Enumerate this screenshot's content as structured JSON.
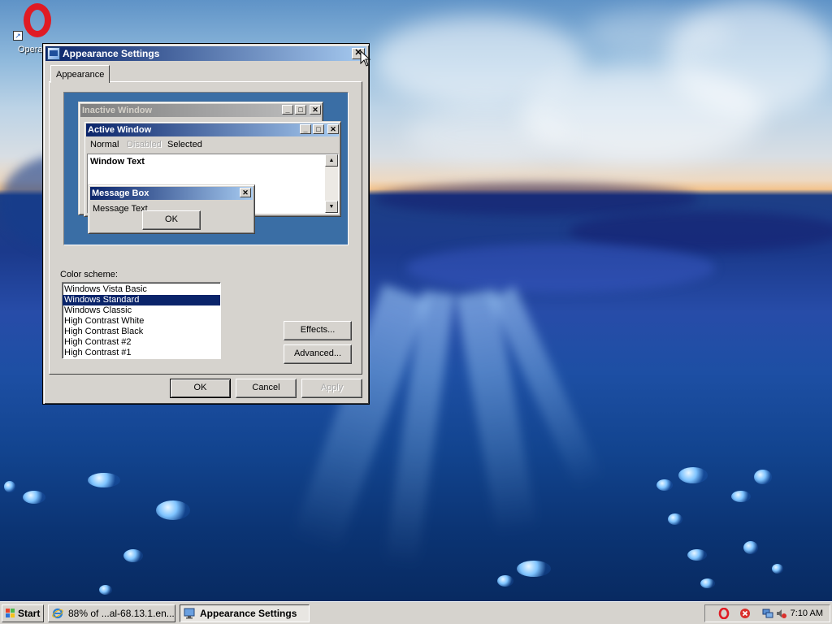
{
  "desktop": {
    "icons": [
      {
        "label": "Opera",
        "icon": "opera-icon"
      }
    ]
  },
  "dialog": {
    "title": "Appearance Settings",
    "close_label": "✕",
    "tab_label": "Appearance",
    "preview": {
      "inactive_title": "Inactive Window",
      "active_title": "Active Window",
      "menu_normal": "Normal",
      "menu_disabled": "Disabled",
      "menu_selected": "Selected",
      "window_text": "Window Text",
      "message_box_title": "Message Box",
      "message_text": "Message Text",
      "message_ok": "OK"
    },
    "color_scheme_label": "Color scheme:",
    "color_schemes": [
      "Windows Vista Basic",
      "Windows Standard",
      "Windows Classic",
      "High Contrast White",
      "High Contrast Black",
      "High Contrast #2",
      "High Contrast #1"
    ],
    "selected_scheme_index": 1,
    "effects_label": "Effects...",
    "advanced_label": "Advanced...",
    "ok_label": "OK",
    "cancel_label": "Cancel",
    "apply_label": "Apply"
  },
  "taskbar": {
    "start_label": "Start",
    "tasks": [
      {
        "label": "88% of ...al-68.13.1.en...",
        "icon": "internet-explorer-icon",
        "active": false
      },
      {
        "label": "Appearance Settings",
        "icon": "display-settings-icon",
        "active": true
      }
    ],
    "clock": "7:10 AM",
    "tray_icons": [
      "opera-tray-icon",
      "security-alert-icon",
      "network-icon",
      "volume-muted-icon"
    ]
  },
  "colors": {
    "active_title_start": "#0a246a",
    "active_title_end": "#a6caf0",
    "inactive_title_start": "#808080",
    "preview_desktop": "#3a6ea5",
    "selection": "#0a246a",
    "face": "#d6d3ce"
  }
}
